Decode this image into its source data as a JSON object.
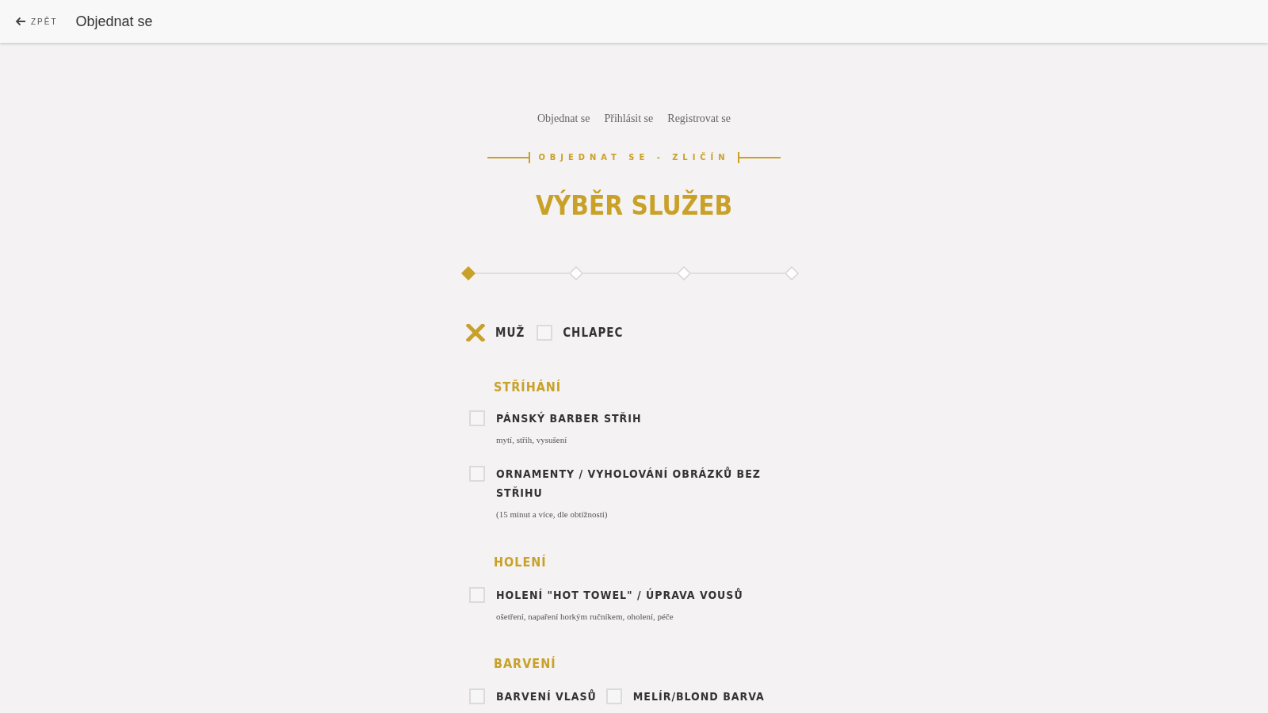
{
  "top_bar": {
    "back_link": "ZPĚT",
    "title": "Objednat se"
  },
  "nav_links": [
    "Objednat se",
    "Přihlásit se",
    "Registrovat se"
  ],
  "subtitle": "OBJEDNAT SE - ZLIČÍN",
  "heading": "VÝBĚR SLUŽEB",
  "stepper": {
    "steps": [
      {
        "selected": true
      },
      {
        "selected": false
      },
      {
        "selected": false
      },
      {
        "selected": false
      }
    ]
  },
  "customer_type": [
    {
      "label": "MUŽ",
      "checked": true
    },
    {
      "label": "CHLAPEC",
      "checked": false
    }
  ],
  "sections": [
    {
      "title": "STŘÍHÁNÍ",
      "kind": "list",
      "services": [
        {
          "name": "PÁNSKÝ BARBER STŘIH",
          "description": "mytí, střih, vysušení",
          "checked": false
        },
        {
          "name": "ORNAMENTY / VYHOLOVÁNÍ OBRÁZKŮ BEZ STŘIHU",
          "description": "(15 minut a více, dle obtížnosti)",
          "checked": false
        }
      ]
    },
    {
      "title": "HOLENÍ",
      "kind": "list",
      "services": [
        {
          "name": "HOLENÍ \"HOT TOWEL\" / ÚPRAVA VOUSŮ",
          "description": "ošetření, napaření horkým ručníkem, oholení, péče",
          "checked": false
        }
      ]
    },
    {
      "title": "BARVENÍ",
      "kind": "row",
      "services": [
        {
          "name": "BARVENÍ VLASŮ",
          "checked": false
        },
        {
          "name": "MELÍR/BLOND BARVA",
          "checked": false
        }
      ]
    }
  ]
}
